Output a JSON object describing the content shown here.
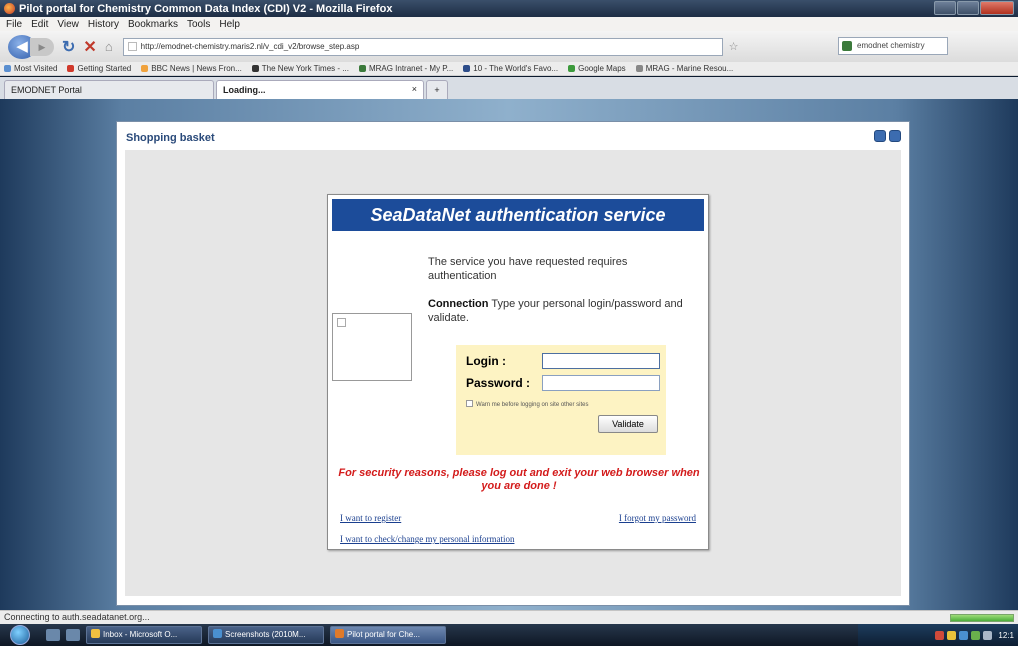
{
  "window": {
    "title": "Pilot portal for Chemistry Common Data Index (CDI) V2 - Mozilla Firefox"
  },
  "menu": [
    "File",
    "Edit",
    "View",
    "History",
    "Bookmarks",
    "Tools",
    "Help"
  ],
  "nav": {
    "url": "http://emodnet-chemistry.maris2.nl/v_cdi_v2/browse_step.asp",
    "search_value": "emodnet chemistry"
  },
  "bookmarks": [
    {
      "label": "Most Visited",
      "color": "#5a8fd0"
    },
    {
      "label": "Getting Started",
      "color": "#d0392b"
    },
    {
      "label": "BBC News | News Fron...",
      "color": "#f0a23c"
    },
    {
      "label": "The New York Times - ...",
      "color": "#333333"
    },
    {
      "label": "MRAG Intranet - My P...",
      "color": "#3b7a3b"
    },
    {
      "label": "10 - The World's Favo...",
      "color": "#2d4d8a"
    },
    {
      "label": "Google Maps",
      "color": "#3c9a3c"
    },
    {
      "label": "MRAG - Marine Resou...",
      "color": "#888888"
    }
  ],
  "tabs": {
    "tab1": "EMODNET Portal",
    "tab2": "Loading...",
    "close": "×",
    "new": "+"
  },
  "panel": {
    "title": "Shopping basket"
  },
  "auth": {
    "header": "SeaDataNet authentication service",
    "intro": "The service you have requested requires authentication",
    "connection_bold": "Connection",
    "connection_text": " Type your personal login/password and validate.",
    "login_label": "Login :",
    "password_label": "Password :",
    "login_value": "",
    "password_value": "",
    "remember_label": "Warn me before logging on site other sites",
    "validate_label": "Validate",
    "warning": "For security reasons, please log out and exit your web browser when you are done !",
    "register_link": "I want to register",
    "forgot_link": "I forgot my password",
    "check_link": "I want to check/change my personal information"
  },
  "status": {
    "text": "Connecting to auth.seadatanet.org...",
    "progress": 1.0
  },
  "taskbar": {
    "items": [
      {
        "label": "Inbox - Microsoft O...",
        "color": "#f0c040"
      },
      {
        "label": "Screenshots (2010M...",
        "color": "#4a90d0"
      },
      {
        "label": "Pilot portal for Che...",
        "color": "#e07a2a"
      }
    ],
    "time": "12:1"
  }
}
